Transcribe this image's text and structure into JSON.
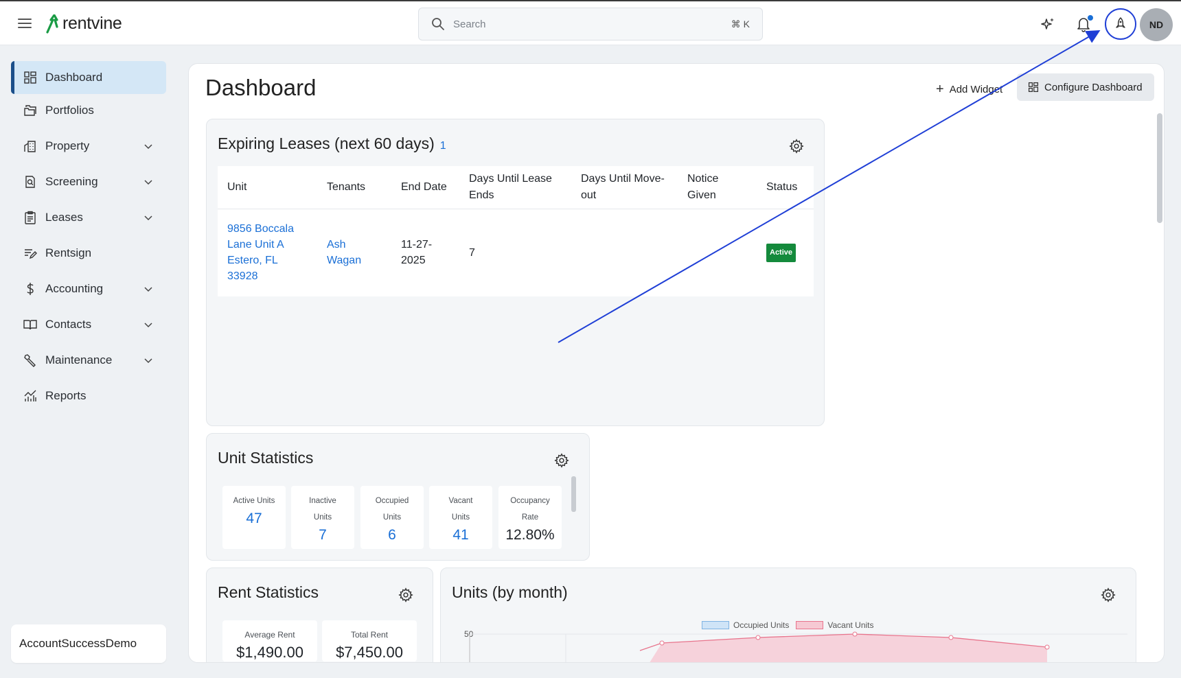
{
  "app": {
    "brand": "rentvine",
    "brand_color": "#1a9b45"
  },
  "header": {
    "search_placeholder": "Search",
    "search_shortcut": "⌘ K",
    "icons": [
      "menu-icon",
      "sparkle-icon",
      "bell-icon",
      "rocket-icon"
    ],
    "avatar_initials": "ND"
  },
  "sidebar": {
    "items": [
      {
        "label": "Dashboard",
        "icon": "dashboard-icon",
        "active": true
      },
      {
        "label": "Portfolios",
        "icon": "folders-icon"
      },
      {
        "label": "Property",
        "icon": "building-icon",
        "expandable": true
      },
      {
        "label": "Screening",
        "icon": "screening-icon",
        "expandable": true
      },
      {
        "label": "Leases",
        "icon": "clipboard-icon",
        "expandable": true
      },
      {
        "label": "Rentsign",
        "icon": "sign-icon"
      },
      {
        "label": "Accounting",
        "icon": "dollar-icon",
        "expandable": true
      },
      {
        "label": "Contacts",
        "icon": "book-icon",
        "expandable": true
      },
      {
        "label": "Maintenance",
        "icon": "wrench-icon",
        "expandable": true
      },
      {
        "label": "Reports",
        "icon": "chart-icon"
      }
    ],
    "account": "AccountSuccessDemo"
  },
  "main": {
    "title": "Dashboard",
    "add_widget": "Add Widget",
    "configure_dashboard": "Configure Dashboard"
  },
  "expiring_leases": {
    "title": "Expiring Leases (next 60 days)",
    "count": "1",
    "columns": [
      "Unit",
      "Tenants",
      "End Date",
      "Days Until Lease Ends",
      "Days Until Move-out",
      "Notice Given",
      "Status"
    ],
    "rows": [
      {
        "unit": "9856 Boccala Lane Unit A Estero, FL 33928",
        "tenants": "Ash Wagan",
        "end_date": "11-27-2025",
        "days_until_lease_ends": "7",
        "days_until_move_out": "",
        "notice_given": "",
        "status": "Active"
      }
    ]
  },
  "unit_statistics": {
    "title": "Unit Statistics",
    "stats": [
      {
        "label": "Active Units",
        "value": "47"
      },
      {
        "label": "Inactive Units",
        "value": "7"
      },
      {
        "label": "Occupied Units",
        "value": "6"
      },
      {
        "label": "Vacant Units",
        "value": "41"
      },
      {
        "label": "Occupancy Rate",
        "value": "12.80%"
      }
    ]
  },
  "rent_statistics": {
    "title": "Rent Statistics",
    "stats": [
      {
        "label": "Average Rent",
        "value": "$1,490.00"
      },
      {
        "label": "Total Rent",
        "value": "$7,450.00"
      }
    ]
  },
  "units_by_month": {
    "title": "Units (by month)",
    "legend": [
      "Occupied Units",
      "Vacant Units"
    ],
    "colors": {
      "occupied": "#cfe4f7",
      "vacant": "#f6c9d3",
      "vacant_line": "#e8748c"
    },
    "y_tick_top": "50"
  }
}
